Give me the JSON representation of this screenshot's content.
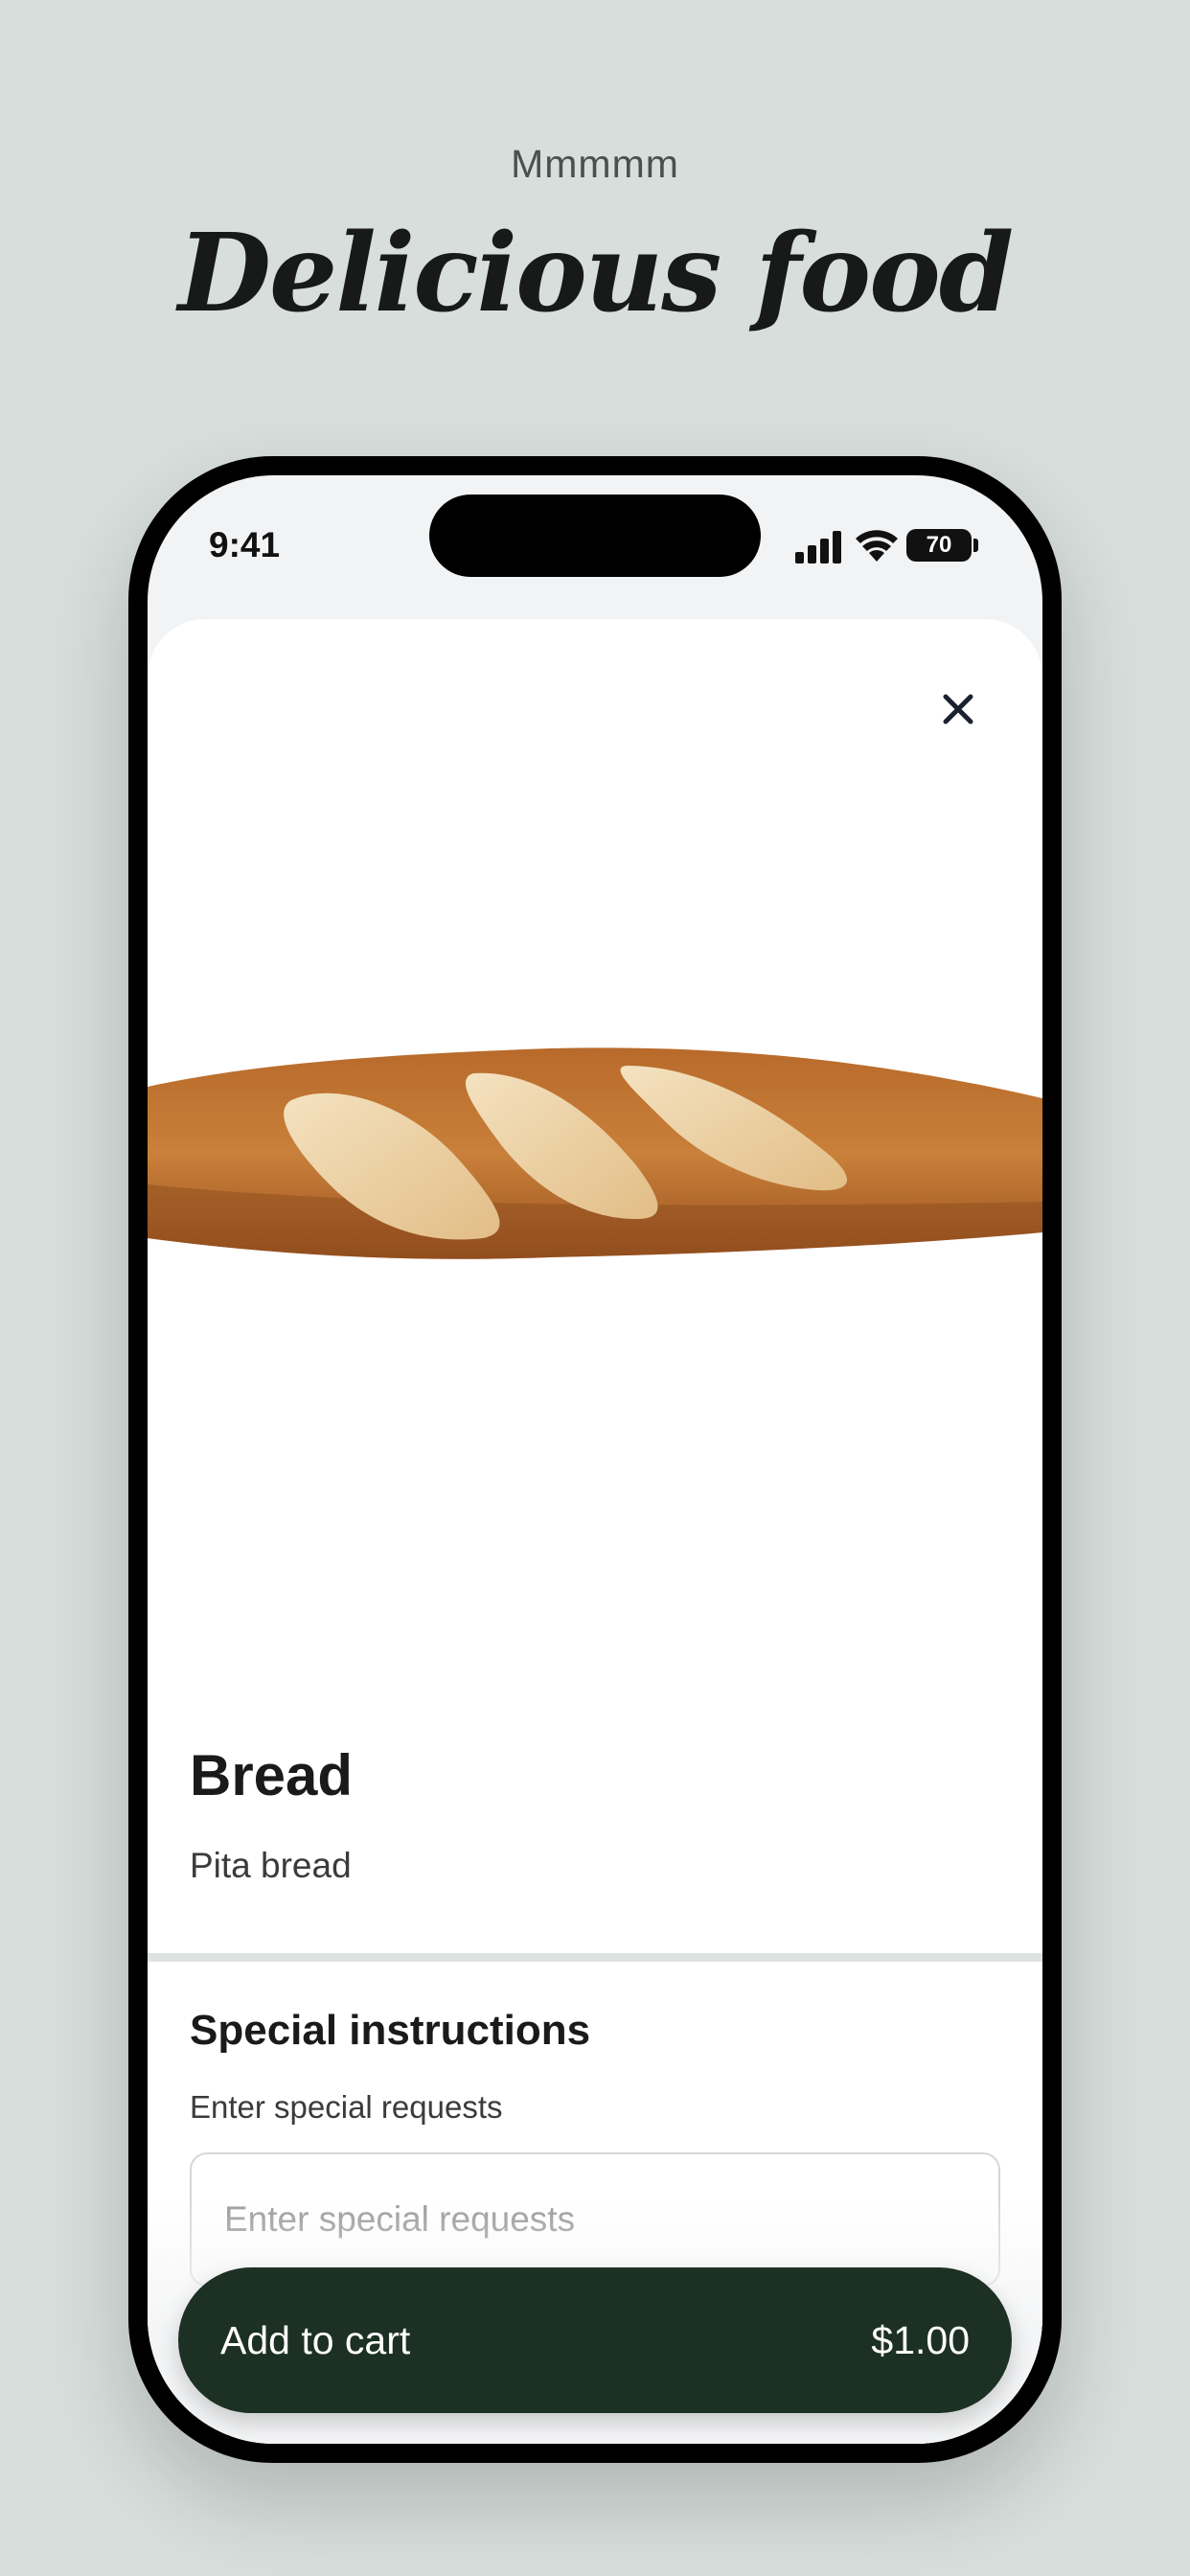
{
  "header": {
    "eyebrow": "Mmmmm",
    "headline": "Delicious food"
  },
  "status_bar": {
    "time": "9:41",
    "battery": "70",
    "icons": [
      "signal-icon",
      "wifi-icon",
      "battery-icon"
    ]
  },
  "product": {
    "image_icon": "baguette-image",
    "title": "Bread",
    "description": "Pita bread"
  },
  "instructions": {
    "section_title": "Special instructions",
    "label": "Enter special requests",
    "placeholder": "Enter special requests",
    "value": ""
  },
  "cart": {
    "button_label": "Add to cart",
    "price": "$1.00"
  },
  "colors": {
    "background": "#d7dedb",
    "cart_button": "#1d3024",
    "divider": "#dde3e0"
  }
}
